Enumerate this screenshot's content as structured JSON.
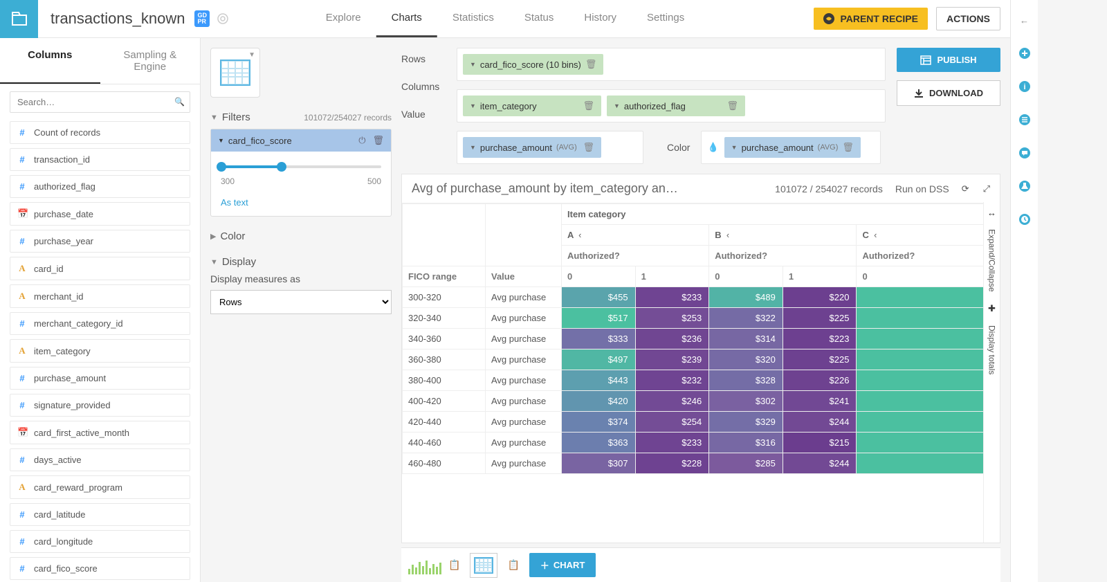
{
  "header": {
    "dataset_name": "transactions_known",
    "gdpr_badge": "GD\nPR",
    "tabs": [
      "Explore",
      "Charts",
      "Statistics",
      "Status",
      "History",
      "Settings"
    ],
    "active_tab": "Charts",
    "parent_recipe_label": "PARENT RECIPE",
    "actions_label": "ACTIONS"
  },
  "sidebar": {
    "tabs": [
      "Columns",
      "Sampling & Engine"
    ],
    "active_tab": "Columns",
    "search_placeholder": "Search…",
    "columns": [
      {
        "type": "num",
        "name": "Count of records"
      },
      {
        "type": "num",
        "name": "transaction_id"
      },
      {
        "type": "num",
        "name": "authorized_flag"
      },
      {
        "type": "date",
        "name": "purchase_date"
      },
      {
        "type": "num",
        "name": "purchase_year"
      },
      {
        "type": "text",
        "name": "card_id"
      },
      {
        "type": "text",
        "name": "merchant_id"
      },
      {
        "type": "num",
        "name": "merchant_category_id"
      },
      {
        "type": "text",
        "name": "item_category"
      },
      {
        "type": "num",
        "name": "purchase_amount"
      },
      {
        "type": "num",
        "name": "signature_provided"
      },
      {
        "type": "date",
        "name": "card_first_active_month"
      },
      {
        "type": "num",
        "name": "days_active"
      },
      {
        "type": "text",
        "name": "card_reward_program"
      },
      {
        "type": "num",
        "name": "card_latitude"
      },
      {
        "type": "num",
        "name": "card_longitude"
      },
      {
        "type": "num",
        "name": "card_fico_score"
      }
    ]
  },
  "config": {
    "filters_label": "Filters",
    "filters_records": "101072/254027 records",
    "filter": {
      "name": "card_fico_score",
      "min": "300",
      "max": "500",
      "fillPercent": 38
    },
    "as_text": "As text",
    "color_label": "Color",
    "display_label": "Display",
    "display_measures_label": "Display measures as",
    "display_option": "Rows"
  },
  "zones": {
    "rows_label": "Rows",
    "columns_label": "Columns",
    "value_label": "Value",
    "color_label": "Color",
    "rows": [
      {
        "label": "card_fico_score (10 bins)"
      }
    ],
    "columns": [
      {
        "label": "item_category"
      },
      {
        "label": "authorized_flag"
      }
    ],
    "value": [
      {
        "label": "purchase_amount",
        "agg": "(AVG)"
      }
    ],
    "color": [
      {
        "label": "purchase_amount",
        "agg": "(AVG)"
      }
    ],
    "publish_label": "PUBLISH",
    "download_label": "DOWNLOAD"
  },
  "pivot": {
    "title": "Avg of purchase_amount by item_category an…",
    "records": "101072 / 254027 records",
    "run_label": "Run on DSS",
    "item_category_label": "Item category",
    "authorized_label": "Authorized?",
    "fico_range_label": "FICO range",
    "value_label": "Value",
    "col_groups": [
      "A",
      "B",
      "C"
    ],
    "sub_cols": [
      "0",
      "1"
    ],
    "row_value_label": "Avg purchase",
    "row_keys": [
      "300-320",
      "320-340",
      "340-360",
      "360-380",
      "380-400",
      "400-420",
      "420-440",
      "440-460",
      "460-480"
    ],
    "expand_label": "Expand/Collapse",
    "totals_label": "Display totals"
  },
  "bottom": {
    "chart_label": "CHART"
  },
  "chart_data": {
    "type": "table",
    "title": "Avg of purchase_amount by item_category and authorized_flag",
    "row_dimension": "card_fico_score (10 bins)",
    "column_dimensions": [
      "item_category",
      "authorized_flag"
    ],
    "measure": "purchase_amount",
    "aggregation": "AVG",
    "columns": [
      {
        "item_category": "A",
        "authorized_flag": "0"
      },
      {
        "item_category": "A",
        "authorized_flag": "1"
      },
      {
        "item_category": "B",
        "authorized_flag": "0"
      },
      {
        "item_category": "B",
        "authorized_flag": "1"
      },
      {
        "item_category": "C",
        "authorized_flag": "0"
      }
    ],
    "rows": [
      {
        "key": "300-320",
        "values": [
          455,
          233,
          489,
          220,
          null
        ]
      },
      {
        "key": "320-340",
        "values": [
          517,
          253,
          322,
          225,
          null
        ]
      },
      {
        "key": "340-360",
        "values": [
          333,
          236,
          314,
          223,
          null
        ]
      },
      {
        "key": "360-380",
        "values": [
          497,
          239,
          320,
          225,
          null
        ]
      },
      {
        "key": "380-400",
        "values": [
          443,
          232,
          328,
          226,
          null
        ]
      },
      {
        "key": "400-420",
        "values": [
          420,
          246,
          302,
          241,
          null
        ]
      },
      {
        "key": "420-440",
        "values": [
          374,
          254,
          329,
          244,
          null
        ]
      },
      {
        "key": "440-460",
        "values": [
          363,
          233,
          316,
          215,
          null
        ]
      },
      {
        "key": "460-480",
        "values": [
          307,
          228,
          285,
          244,
          null
        ]
      }
    ],
    "color_scale": {
      "min": 215,
      "max": 517,
      "low_color": "#4bc0a0",
      "high_color": "#6b3d8e"
    }
  }
}
